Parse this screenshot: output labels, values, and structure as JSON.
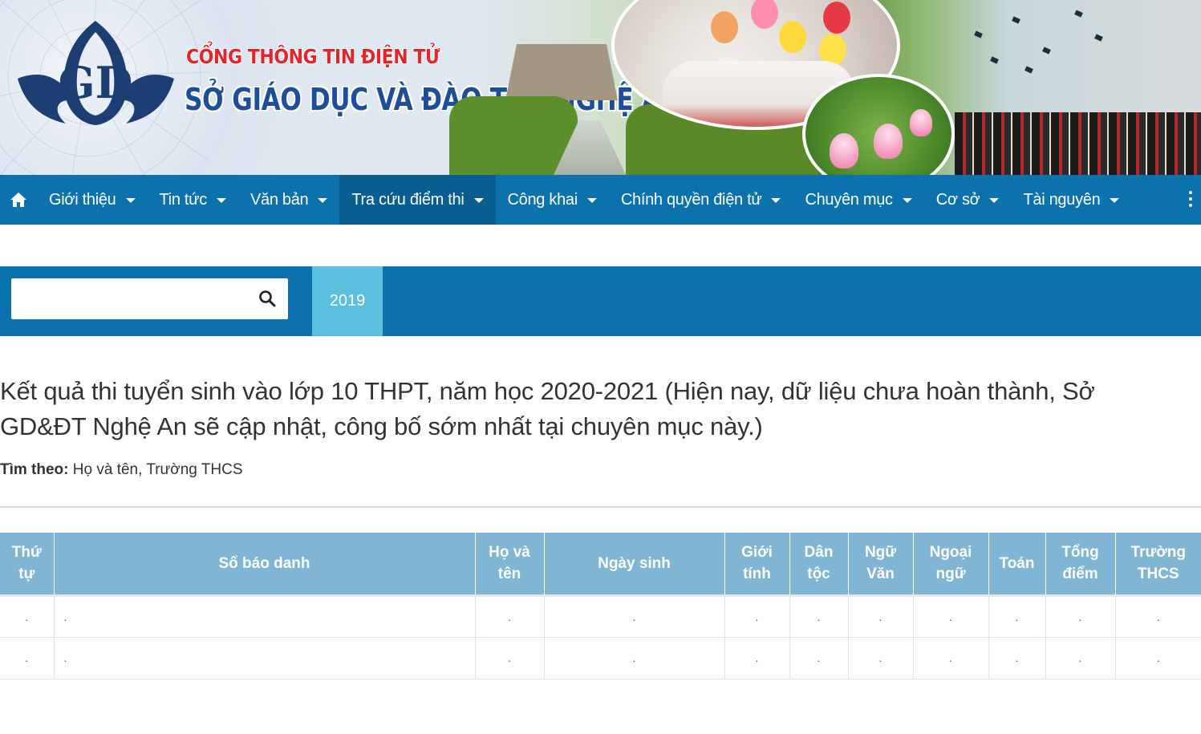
{
  "header": {
    "subtitle": "CỔNG THÔNG TIN ĐIỆN TỬ",
    "title": "SỞ GIÁO DỤC VÀ ĐÀO TẠO NGHỆ AN",
    "logo_icon": "gd-lotus-logo"
  },
  "nav": {
    "home_icon": "home-icon",
    "items": [
      {
        "label": "Giới thiệu"
      },
      {
        "label": "Tin tức"
      },
      {
        "label": "Văn bản"
      },
      {
        "label": "Tra cứu điểm thi",
        "active": true
      },
      {
        "label": "Công khai"
      },
      {
        "label": "Chính quyền điện tử"
      },
      {
        "label": "Chuyên mục"
      },
      {
        "label": "Cơ sở"
      },
      {
        "label": "Tài nguyên"
      }
    ],
    "more_icon": "more-vertical-icon"
  },
  "search": {
    "value": "",
    "placeholder": "",
    "icon": "search-icon",
    "year_tab": "2019"
  },
  "content": {
    "heading": "Kết quả thi tuyển sinh vào lớp 10 THPT, năm học 2020-2021 (Hiện nay, dữ liệu chưa hoàn thành, Sở GD&ĐT Nghệ An sẽ cập nhật, công bố sớm nhất tại chuyên mục này.)",
    "search_by_label": "Tìm theo:",
    "search_by_value": "Họ và tên, Trường THCS"
  },
  "table": {
    "columns": [
      "Thứ tự",
      "Số báo danh",
      "Họ và tên",
      "Ngày sinh",
      "Giới tính",
      "Dân tộc",
      "Ngữ Văn",
      "Ngoại ngữ",
      "Toán",
      "Tổng điểm",
      "Trường THCS"
    ],
    "rows": [
      [
        ".",
        ".",
        ".",
        ".",
        ".",
        ".",
        ".",
        ".",
        ".",
        ".",
        "."
      ],
      [
        ".",
        ".",
        ".",
        ".",
        ".",
        ".",
        ".",
        ".",
        ".",
        ".",
        "."
      ]
    ]
  },
  "colors": {
    "nav_bg": "#0b72ae",
    "nav_active": "#095e90",
    "year_tab": "#5bc0de",
    "table_header": "#80b6d3"
  }
}
